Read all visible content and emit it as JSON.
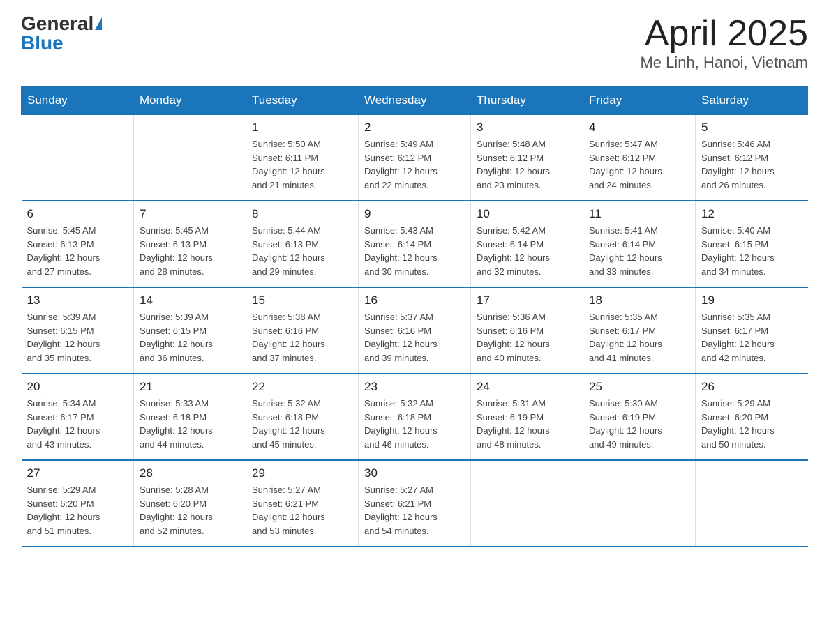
{
  "logo": {
    "general": "General",
    "blue": "Blue"
  },
  "title": "April 2025",
  "subtitle": "Me Linh, Hanoi, Vietnam",
  "headers": [
    "Sunday",
    "Monday",
    "Tuesday",
    "Wednesday",
    "Thursday",
    "Friday",
    "Saturday"
  ],
  "weeks": [
    [
      {
        "day": "",
        "info": ""
      },
      {
        "day": "",
        "info": ""
      },
      {
        "day": "1",
        "info": "Sunrise: 5:50 AM\nSunset: 6:11 PM\nDaylight: 12 hours\nand 21 minutes."
      },
      {
        "day": "2",
        "info": "Sunrise: 5:49 AM\nSunset: 6:12 PM\nDaylight: 12 hours\nand 22 minutes."
      },
      {
        "day": "3",
        "info": "Sunrise: 5:48 AM\nSunset: 6:12 PM\nDaylight: 12 hours\nand 23 minutes."
      },
      {
        "day": "4",
        "info": "Sunrise: 5:47 AM\nSunset: 6:12 PM\nDaylight: 12 hours\nand 24 minutes."
      },
      {
        "day": "5",
        "info": "Sunrise: 5:46 AM\nSunset: 6:12 PM\nDaylight: 12 hours\nand 26 minutes."
      }
    ],
    [
      {
        "day": "6",
        "info": "Sunrise: 5:45 AM\nSunset: 6:13 PM\nDaylight: 12 hours\nand 27 minutes."
      },
      {
        "day": "7",
        "info": "Sunrise: 5:45 AM\nSunset: 6:13 PM\nDaylight: 12 hours\nand 28 minutes."
      },
      {
        "day": "8",
        "info": "Sunrise: 5:44 AM\nSunset: 6:13 PM\nDaylight: 12 hours\nand 29 minutes."
      },
      {
        "day": "9",
        "info": "Sunrise: 5:43 AM\nSunset: 6:14 PM\nDaylight: 12 hours\nand 30 minutes."
      },
      {
        "day": "10",
        "info": "Sunrise: 5:42 AM\nSunset: 6:14 PM\nDaylight: 12 hours\nand 32 minutes."
      },
      {
        "day": "11",
        "info": "Sunrise: 5:41 AM\nSunset: 6:14 PM\nDaylight: 12 hours\nand 33 minutes."
      },
      {
        "day": "12",
        "info": "Sunrise: 5:40 AM\nSunset: 6:15 PM\nDaylight: 12 hours\nand 34 minutes."
      }
    ],
    [
      {
        "day": "13",
        "info": "Sunrise: 5:39 AM\nSunset: 6:15 PM\nDaylight: 12 hours\nand 35 minutes."
      },
      {
        "day": "14",
        "info": "Sunrise: 5:39 AM\nSunset: 6:15 PM\nDaylight: 12 hours\nand 36 minutes."
      },
      {
        "day": "15",
        "info": "Sunrise: 5:38 AM\nSunset: 6:16 PM\nDaylight: 12 hours\nand 37 minutes."
      },
      {
        "day": "16",
        "info": "Sunrise: 5:37 AM\nSunset: 6:16 PM\nDaylight: 12 hours\nand 39 minutes."
      },
      {
        "day": "17",
        "info": "Sunrise: 5:36 AM\nSunset: 6:16 PM\nDaylight: 12 hours\nand 40 minutes."
      },
      {
        "day": "18",
        "info": "Sunrise: 5:35 AM\nSunset: 6:17 PM\nDaylight: 12 hours\nand 41 minutes."
      },
      {
        "day": "19",
        "info": "Sunrise: 5:35 AM\nSunset: 6:17 PM\nDaylight: 12 hours\nand 42 minutes."
      }
    ],
    [
      {
        "day": "20",
        "info": "Sunrise: 5:34 AM\nSunset: 6:17 PM\nDaylight: 12 hours\nand 43 minutes."
      },
      {
        "day": "21",
        "info": "Sunrise: 5:33 AM\nSunset: 6:18 PM\nDaylight: 12 hours\nand 44 minutes."
      },
      {
        "day": "22",
        "info": "Sunrise: 5:32 AM\nSunset: 6:18 PM\nDaylight: 12 hours\nand 45 minutes."
      },
      {
        "day": "23",
        "info": "Sunrise: 5:32 AM\nSunset: 6:18 PM\nDaylight: 12 hours\nand 46 minutes."
      },
      {
        "day": "24",
        "info": "Sunrise: 5:31 AM\nSunset: 6:19 PM\nDaylight: 12 hours\nand 48 minutes."
      },
      {
        "day": "25",
        "info": "Sunrise: 5:30 AM\nSunset: 6:19 PM\nDaylight: 12 hours\nand 49 minutes."
      },
      {
        "day": "26",
        "info": "Sunrise: 5:29 AM\nSunset: 6:20 PM\nDaylight: 12 hours\nand 50 minutes."
      }
    ],
    [
      {
        "day": "27",
        "info": "Sunrise: 5:29 AM\nSunset: 6:20 PM\nDaylight: 12 hours\nand 51 minutes."
      },
      {
        "day": "28",
        "info": "Sunrise: 5:28 AM\nSunset: 6:20 PM\nDaylight: 12 hours\nand 52 minutes."
      },
      {
        "day": "29",
        "info": "Sunrise: 5:27 AM\nSunset: 6:21 PM\nDaylight: 12 hours\nand 53 minutes."
      },
      {
        "day": "30",
        "info": "Sunrise: 5:27 AM\nSunset: 6:21 PM\nDaylight: 12 hours\nand 54 minutes."
      },
      {
        "day": "",
        "info": ""
      },
      {
        "day": "",
        "info": ""
      },
      {
        "day": "",
        "info": ""
      }
    ]
  ]
}
